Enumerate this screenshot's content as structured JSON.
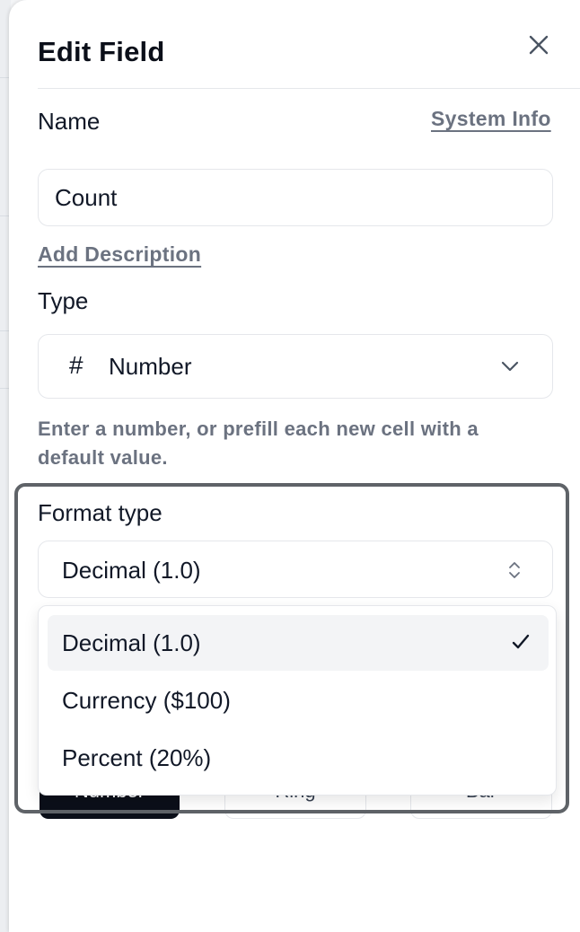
{
  "panel": {
    "title": "Edit Field",
    "name_label": "Name",
    "system_info_link": "System Info",
    "name_value": "Count",
    "add_description_link": "Add Description",
    "type_label": "Type",
    "type_value": "Number",
    "type_icon": "hash-icon",
    "help_text": "Enter a number, or prefill each new cell with a default value.",
    "format_label": "Format type",
    "format_value": "Decimal (1.0)",
    "format_options": [
      {
        "label": "Decimal (1.0)",
        "selected": true
      },
      {
        "label": "Currency ($100)",
        "selected": false
      },
      {
        "label": "Percent (20%)",
        "selected": false
      }
    ],
    "display_options": [
      "Number",
      "Ring",
      "Bar"
    ]
  },
  "colors": {
    "accent": "#0b0f19",
    "muted_text": "#6b7280",
    "border": "#e5e7eb",
    "focus_ring": "#5f6368"
  }
}
